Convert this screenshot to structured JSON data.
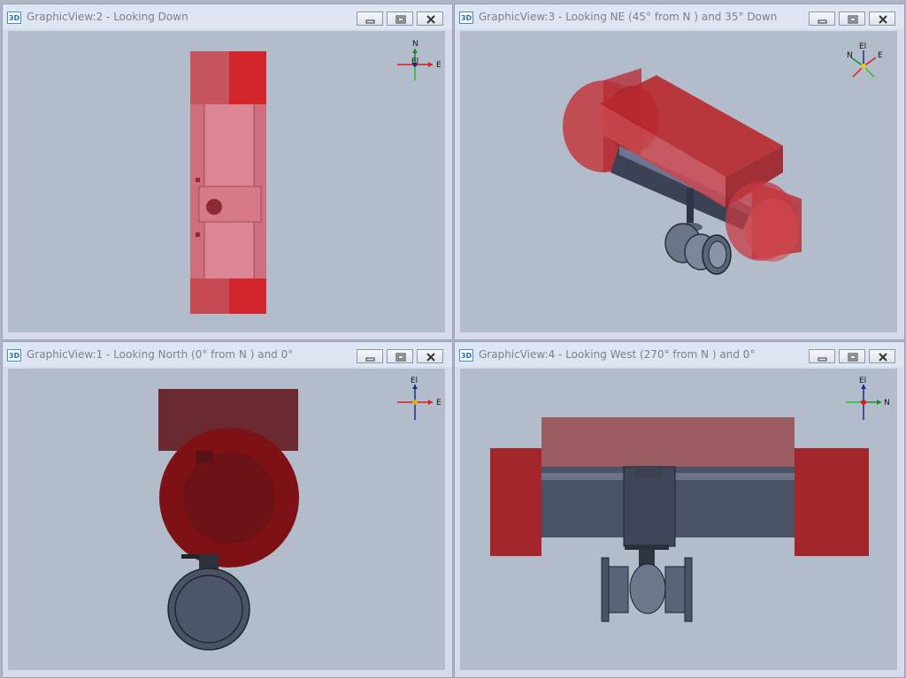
{
  "windows": [
    {
      "title": "GraphicView:2 - Looking Down",
      "icon": "3D",
      "axes": {
        "n": "N",
        "e": "E",
        "el": "El"
      }
    },
    {
      "title": "GraphicView:3 - Looking NE (45° from N ) and 35° Down",
      "icon": "3D",
      "axes": {
        "n": "N",
        "e": "E",
        "el": "El"
      }
    },
    {
      "title": "GraphicView:1 - Looking North (0° from N ) and 0°",
      "icon": "3D",
      "axes": {
        "el": "El",
        "e": "E"
      }
    },
    {
      "title": "GraphicView:4 - Looking West (270° from N ) and 0°",
      "icon": "3D",
      "axes": {
        "el": "El",
        "n": "N"
      }
    }
  ],
  "colors": {
    "viewport_bg": "#b3bccb",
    "red_translucent": "#c0262a",
    "pipe_steel": "#4a5366",
    "titlebar": "#dfe6f3"
  },
  "icons": [
    "3d-view-icon",
    "minimize-icon",
    "restore-icon",
    "close-icon",
    "axis-triad-icon"
  ]
}
